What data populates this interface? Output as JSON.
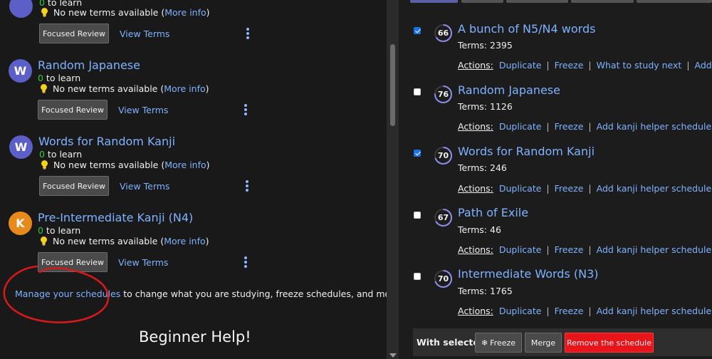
{
  "left": {
    "top_partial": {
      "to_learn_count": "0",
      "to_learn_label": " to learn",
      "status_text": "No new terms available (",
      "more_info": "More info",
      "status_close": ")",
      "focused_review": "Focused Review",
      "view_terms": "View Terms"
    },
    "decks": [
      {
        "avatar_letter": "W",
        "avatar_color": "#5b5fc7",
        "title": "Random Japanese",
        "to_learn_count": "0",
        "to_learn_label": " to learn",
        "status_text": "No new terms available (",
        "more_info": "More info",
        "status_close": ")",
        "focused_review": "Focused Review",
        "view_terms": "View Terms"
      },
      {
        "avatar_letter": "W",
        "avatar_color": "#5b5fc7",
        "title": "Words for Random Kanji",
        "to_learn_count": "0",
        "to_learn_label": " to learn",
        "status_text": "No new terms available (",
        "more_info": "More info",
        "status_close": ")",
        "focused_review": "Focused Review",
        "view_terms": "View Terms"
      },
      {
        "avatar_letter": "K",
        "avatar_color": "#e8891c",
        "title": "Pre-Intermediate Kanji (N4)",
        "to_learn_count": "0",
        "to_learn_label": " to learn",
        "status_text": "No new terms available (",
        "more_info": "More info",
        "status_close": ")",
        "focused_review": "Focused Review",
        "view_terms": "View Terms"
      }
    ],
    "manage_link": "Manage your schedules",
    "manage_rest": " to change what you are studying, freeze schedules, and more!",
    "beginner_help": "Beginner Help!"
  },
  "right": {
    "schedules": [
      {
        "checked": true,
        "score": "66",
        "title": "A bunch of N5/N4 words",
        "terms": "Terms: 2395",
        "actions_label": "Actions:",
        "actions": [
          "Duplicate",
          "Freeze",
          "What to study next",
          "Add kanji"
        ]
      },
      {
        "checked": false,
        "score": "76",
        "title": "Random Japanese",
        "terms": "Terms: 1126",
        "actions_label": "Actions:",
        "actions": [
          "Duplicate",
          "Freeze",
          "Add kanji helper schedule"
        ]
      },
      {
        "checked": true,
        "score": "70",
        "title": "Words for Random Kanji",
        "terms": "Terms: 246",
        "actions_label": "Actions:",
        "actions": [
          "Duplicate",
          "Freeze",
          "Add kanji helper schedule"
        ]
      },
      {
        "checked": false,
        "score": "67",
        "title": "Path of Exile",
        "terms": "Terms: 46",
        "actions_label": "Actions:",
        "actions": [
          "Duplicate",
          "Freeze",
          "Add kanji helper schedule"
        ]
      },
      {
        "checked": false,
        "score": "70",
        "title": "Intermediate Words (N3)",
        "terms": "Terms: 1765",
        "actions_label": "Actions:",
        "actions": [
          "Duplicate",
          "Freeze",
          "Add kanji helper schedule"
        ]
      }
    ],
    "bulk": {
      "label": "With selected:",
      "freeze": "Freeze",
      "merge": "Merge",
      "remove": "Remove the schedule"
    }
  },
  "colors": {
    "link": "#7fb2ff",
    "count_green": "#2ecc40",
    "danger_red": "#e8141a",
    "annotation_red": "#d41a1a"
  }
}
